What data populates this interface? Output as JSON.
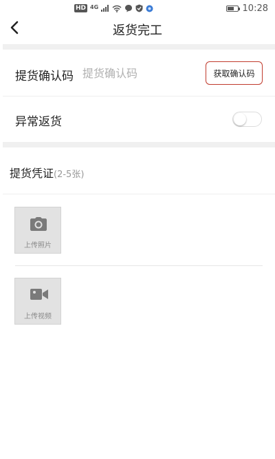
{
  "status_bar": {
    "network_badge": "HD",
    "network_type": "4G",
    "time": "10:28"
  },
  "nav": {
    "title": "返货完工"
  },
  "code_row": {
    "label": "提货确认码",
    "placeholder": "提货确认码",
    "value": "",
    "get_code_label": "获取确认码",
    "button_border_color": "#c0392b"
  },
  "abnormal_return": {
    "label": "异常返货",
    "enabled": false
  },
  "voucher": {
    "title": "提货凭证",
    "count_hint": "(2-5张)"
  },
  "uploads": {
    "photo_label": "上传照片",
    "photo_icon": "camera-icon",
    "video_label": "上传视频",
    "video_icon": "video-camera-icon"
  }
}
